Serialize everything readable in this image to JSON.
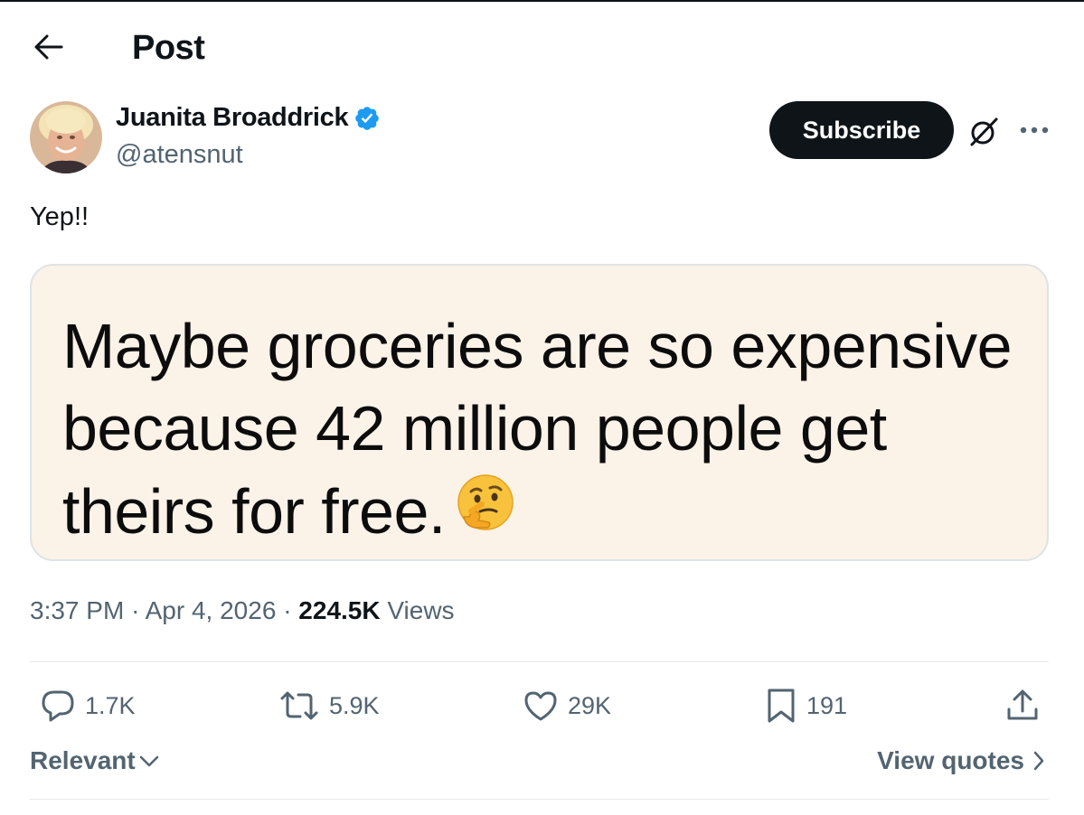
{
  "header": {
    "title": "Post",
    "back_icon": "arrow-left-icon"
  },
  "author": {
    "name": "Juanita Broaddrick",
    "handle": "@atensnut",
    "verified_color": "#1d9bf0"
  },
  "actions_top": {
    "subscribe_label": "Subscribe",
    "grok_icon": "grok-icon",
    "more_icon": "more-horizontal-icon"
  },
  "tweet": {
    "text": "Yep!!",
    "media_text": "Maybe groceries are so expensive because 42 million people get theirs for free.",
    "media_emoji": "thinking-face-emoji"
  },
  "meta": {
    "time": "3:37 PM",
    "separator": "·",
    "date": "Apr 4, 2026",
    "views_count": "224.5K",
    "views_label": "Views"
  },
  "engagement": {
    "replies": "1.7K",
    "reposts": "5.9K",
    "likes": "29K",
    "bookmarks": "191"
  },
  "footer": {
    "sort_label": "Relevant",
    "view_quotes_label": "View quotes"
  },
  "colors": {
    "primary_text": "#0f1419",
    "secondary_text": "#536471",
    "media_bg": "#fbf2e8",
    "accent": "#1d9bf0"
  }
}
